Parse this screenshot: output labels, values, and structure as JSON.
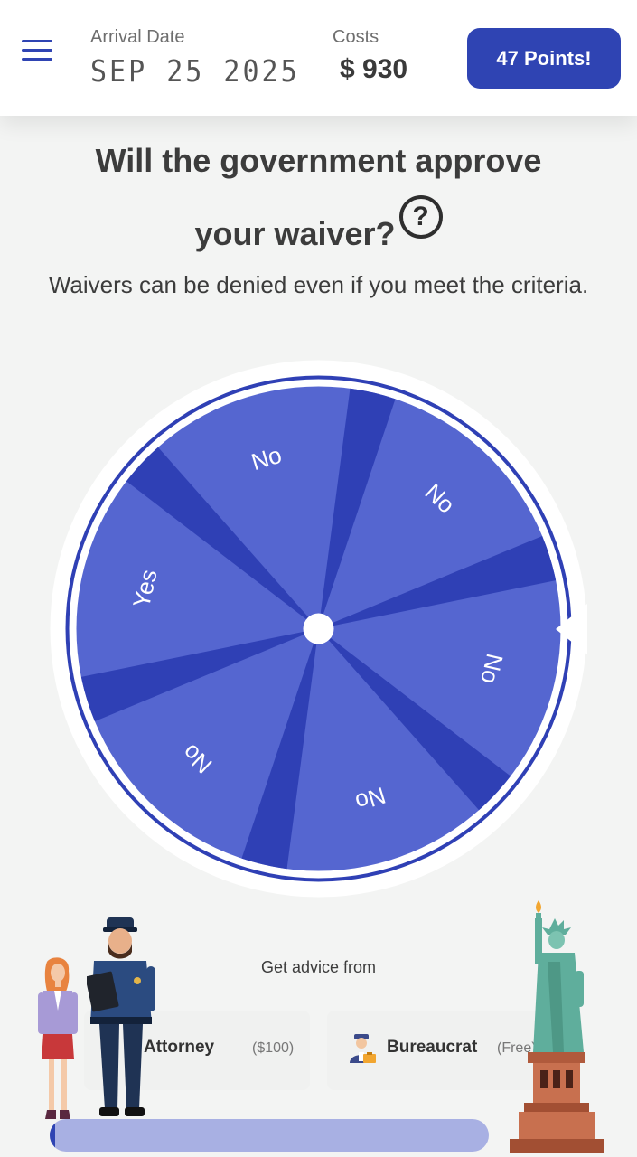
{
  "header": {
    "arrival_label": "Arrival Date",
    "arrival_date": "SEP 25 2025",
    "costs_label": "Costs",
    "costs_value": "$ 930",
    "points_label": "47 Points!"
  },
  "question": {
    "line1": "Will the government approve",
    "line2": "your waiver?",
    "help_symbol": "?",
    "subtitle": "Waivers can be denied even if you meet the criteria."
  },
  "wheel": {
    "segments": [
      "No",
      "No",
      "No",
      "No",
      "Yes",
      "No"
    ],
    "colors": {
      "segment": "#5566d0",
      "divider": "#2f40b5",
      "rim": "#2f40b5",
      "hub": "#ffffff"
    }
  },
  "advice": {
    "label": "Get advice from",
    "advisors": [
      {
        "name": "Attorney",
        "price": "($100)"
      },
      {
        "name": "Bureaucrat",
        "price": "(Free)"
      }
    ]
  },
  "progress": {
    "fraction": 0.01
  },
  "icons": {
    "menu": "hamburger-menu-icon",
    "help": "question-circle-icon",
    "bureaucrat": "bureaucrat-icon"
  }
}
